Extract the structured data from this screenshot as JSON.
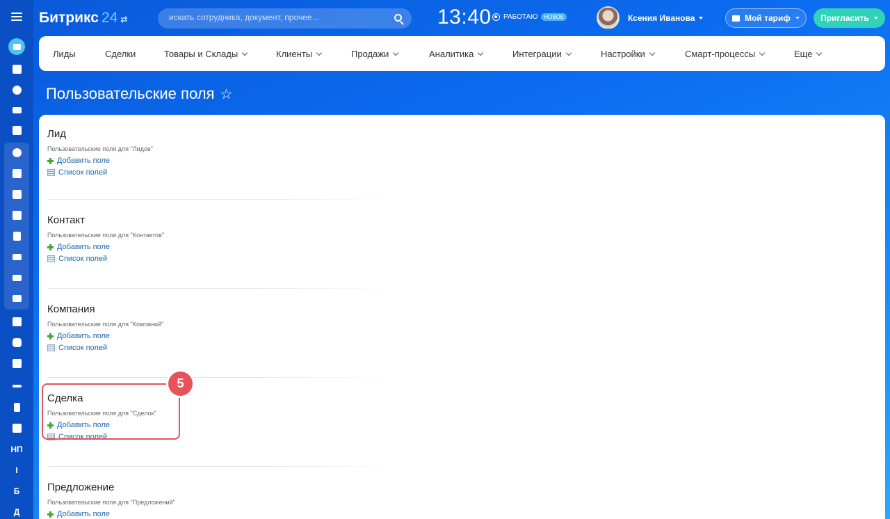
{
  "app": {
    "logo_name": "Битрикс",
    "logo_num": "24",
    "logo_switch": "⇄"
  },
  "search": {
    "placeholder": "искать сотрудника, документ, прочее..."
  },
  "clock": {
    "time": "13:40",
    "status": "РАБОТАЮ",
    "badge": "НОВОЕ"
  },
  "user": {
    "name": "Ксения Иванова"
  },
  "buttons": {
    "tariff": "Мой тариф",
    "invite": "Пригласить"
  },
  "menu": {
    "items": [
      "Лиды",
      "Сделки",
      "Товары и Склады",
      "Клиенты",
      "Продажи",
      "Аналитика",
      "Интеграции",
      "Настройки",
      "Смарт-процессы",
      "Еще"
    ]
  },
  "page": {
    "title": "Пользовательские поля"
  },
  "rail": {
    "np": "НП",
    "i": "I",
    "b": "Б",
    "d": "Д"
  },
  "sections": [
    {
      "title": "Лид",
      "desc": "Пользовательские поля для \"Лидов\"",
      "add": "Добавить поле",
      "list": "Список полей"
    },
    {
      "title": "Контакт",
      "desc": "Пользовательские поля для \"Контактов\"",
      "add": "Добавить поле",
      "list": "Список полей"
    },
    {
      "title": "Компания",
      "desc": "Пользовательские поля для \"Компаний\"",
      "add": "Добавить поле",
      "list": "Список полей"
    },
    {
      "title": "Сделка",
      "desc": "Пользовательские поля для \"Сделок\"",
      "add": "Добавить поле",
      "list": "Список полей"
    },
    {
      "title": "Предложение",
      "desc": "Пользовательские поля для \"Предложений\"",
      "add": "Добавить поле"
    }
  ],
  "annotation": {
    "step": "5"
  },
  "colors": {
    "accent": "#2fd3ba",
    "highlight": "#e8535a",
    "link": "#2067b0"
  }
}
